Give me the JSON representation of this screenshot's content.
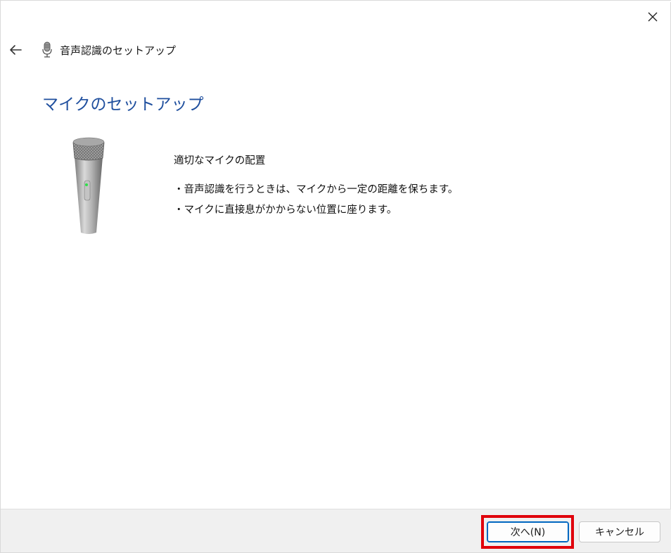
{
  "header": {
    "breadcrumb_title": "音声認識のセットアップ"
  },
  "main": {
    "title": "マイクのセットアップ",
    "heading": "適切なマイクの配置",
    "bullets": [
      "・音声認識を行うときは、マイクから一定の距離を保ちます。",
      "・マイクに直接息がかからない位置に座ります。"
    ]
  },
  "footer": {
    "next_label": "次へ(N)",
    "cancel_label": "キャンセル"
  },
  "colors": {
    "title_blue": "#1f4f9e",
    "highlight_red": "#e0000b",
    "primary_border": "#0067c0",
    "footer_bg": "#f0f0f0"
  },
  "icons": [
    "close-icon",
    "back-arrow-icon",
    "microphone-icon",
    "microphone-illustration"
  ]
}
